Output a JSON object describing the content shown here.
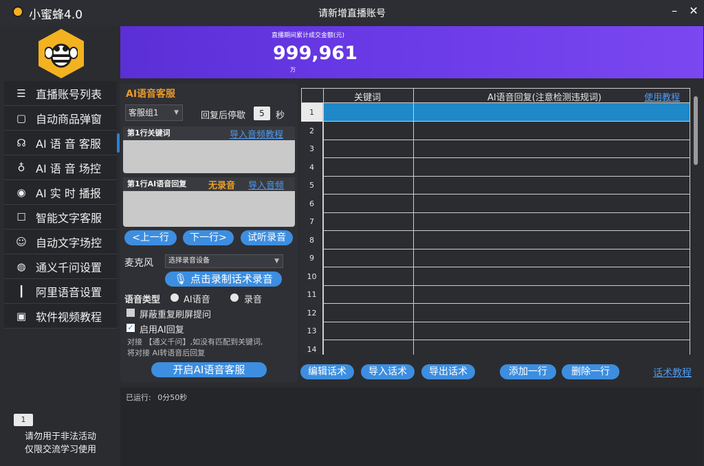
{
  "titlebar": {
    "app_name": "小蜜蜂4.0",
    "window_title": "请新增直播账号",
    "minimize_glyph": "–",
    "close_glyph": "✕"
  },
  "sidebar": {
    "items": [
      {
        "label": "直播账号列表",
        "icon": "list-icon"
      },
      {
        "label": "自动商品弹窗",
        "icon": "bag-icon"
      },
      {
        "label": "AI 语 音 客服",
        "icon": "voice-service-icon"
      },
      {
        "label": "AI 语 音 场控",
        "icon": "microphone-icon"
      },
      {
        "label": "AI 实 时 播报",
        "icon": "broadcast-icon"
      },
      {
        "label": "智能文字客服",
        "icon": "chat-icon"
      },
      {
        "label": "自动文字场控",
        "icon": "users-icon"
      },
      {
        "label": "通义千问设置",
        "icon": "robot-icon"
      },
      {
        "label": "阿里语音设置",
        "icon": "waveform-icon"
      },
      {
        "label": "软件视频教程",
        "icon": "video-icon"
      }
    ],
    "badge": "1",
    "warning_line1": "请勿用于非法活动",
    "warning_line2": "仅限交流学习使用"
  },
  "banner": {
    "label": "直播期间累计成交金额(元)",
    "value": "999,961",
    "unit": "万"
  },
  "panel": {
    "title": "AI语音客服",
    "group_select": "客服组1",
    "pause_label": "回复后停歇",
    "pause_value": "5",
    "pause_unit": "秒",
    "keyword_head": "第1行关键词",
    "import_audio_tutorial": "导入音频教程",
    "reply_head": "第1行AI语音回复",
    "no_recording": "无录音",
    "import_audio": "导入音频",
    "prev_row": "<上一行",
    "next_row": "下一行>",
    "listen": "试听录音",
    "mic_label": "麦克风",
    "mic_select": "选择录音设备",
    "record_button": "点击录制话术录音",
    "voice_type_label": "语音类型",
    "opt_ai": "AI语音",
    "opt_record": "录音",
    "block_repeat": "屏蔽重复刷屏提问",
    "enable_ai": "启用AI回复",
    "hint_line1": "对接 【通义千问】,如没有匹配到关键词,",
    "hint_line2": "将对接 AI转语音后回复",
    "start_button": "开启AI语音客服"
  },
  "table": {
    "col_keyword": "关键词",
    "col_reply": "AI语音回复(注意检测违规词)",
    "usage_tutorial": "使用教程",
    "rows": [
      "1",
      "2",
      "3",
      "4",
      "5",
      "6",
      "7",
      "8",
      "9",
      "10",
      "11",
      "12",
      "13",
      "14"
    ],
    "selected_row": 1
  },
  "toolbar": {
    "edit": "编辑话术",
    "import": "导入话术",
    "export": "导出话术",
    "add_row": "添加一行",
    "delete_row": "删除一行",
    "tutorial": "话术教程"
  },
  "status": {
    "running_label": "已运行:",
    "running_time": "0分50秒"
  },
  "colors": {
    "accent": "#3d8ee0",
    "selected_row": "#1e88c8",
    "banner": "#6b3be8",
    "warning": "#e8a02a"
  }
}
